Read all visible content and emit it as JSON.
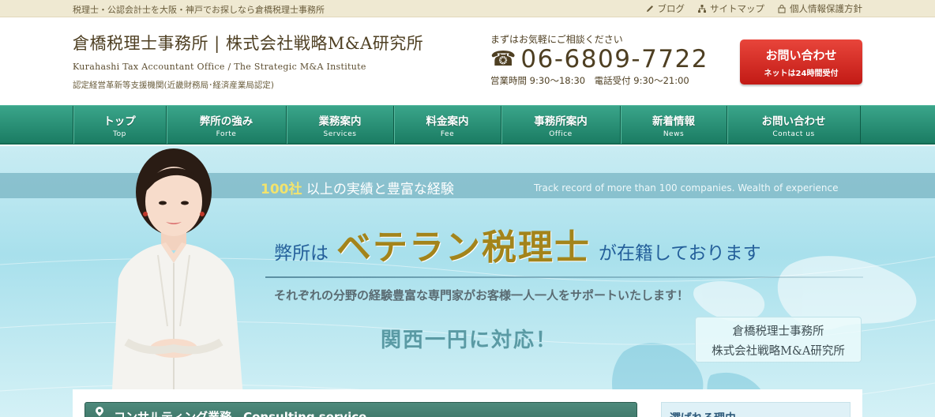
{
  "topbar": {
    "tagline": "税理士・公認会計士を大阪・神戸でお探しなら倉橋税理士事務所",
    "links": [
      {
        "label": "ブログ",
        "icon": "pencil-icon"
      },
      {
        "label": "サイトマップ",
        "icon": "sitemap-icon"
      },
      {
        "label": "個人情報保護方針",
        "icon": "lock-icon"
      }
    ]
  },
  "header": {
    "title": "倉橋税理士事務所 | 株式会社戦略M&A研究所",
    "subtitle_en": "Kurahashi Tax Accountant Office / The Strategic M&A Institute",
    "certification": "認定経営革新等支援機関(近畿財務局･経済産業局認定)",
    "contact_lead": "まずはお気軽にご相談ください",
    "phone_icon": "☎",
    "phone": "06-6809-7722",
    "hours": "営業時間 9:30〜18:30　電話受付 9:30〜21:00",
    "cta_line1": "お問い合わせ",
    "cta_line2": "ネットは24時間受付"
  },
  "nav": [
    {
      "jp": "トップ",
      "en": "Top"
    },
    {
      "jp": "弊所の強み",
      "en": "Forte"
    },
    {
      "jp": "業務案内",
      "en": "Services"
    },
    {
      "jp": "料金案内",
      "en": "Fee"
    },
    {
      "jp": "事務所案内",
      "en": "Office"
    },
    {
      "jp": "新着情報",
      "en": "News"
    },
    {
      "jp": "お問い合わせ",
      "en": "Contact us"
    }
  ],
  "hero": {
    "strip_highlight": "100社",
    "strip_rest": " 以上の実績と豊富な経験",
    "strip_en": "Track record of more than 100 companies. Wealth of experience",
    "copy_pre": "弊所は",
    "copy_big": "ベテラン税理士",
    "copy_post": "が在籍しております",
    "sub_copy": "それぞれの分野の経験豊富な専門家がお客様一人一人をサポートいたします！",
    "region": "関西一円に対応！",
    "name_line1": "倉橋税理士事務所",
    "name_line2": "株式会社戦略M&A研究所"
  },
  "content": {
    "section_title": "コンサルティング業務　Consulting service",
    "side_title": "選ばれる理由"
  },
  "colors": {
    "nav_green": "#1b7c63",
    "cta_red": "#c21a15",
    "brand_brown": "#4e3f22",
    "hero_gold": "#a3841b"
  }
}
